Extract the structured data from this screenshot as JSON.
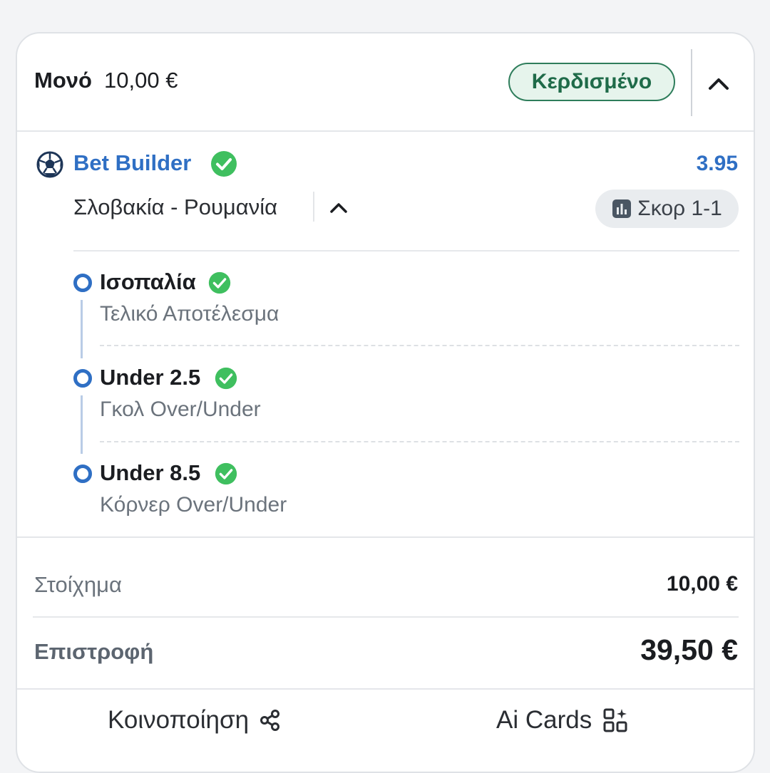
{
  "header": {
    "bet_type": "Μονό",
    "stake": "10,00 €",
    "status": "Κερδισμένο"
  },
  "builder": {
    "label": "Bet Builder",
    "odds": "3.95",
    "match": "Σλοβακία - Ρουμανία",
    "score": "Σκορ 1-1"
  },
  "selections": [
    {
      "name": "Ισοπαλία",
      "market": "Τελικό Αποτέλεσμα"
    },
    {
      "name": "Under 2.5",
      "market": "Γκολ Over/Under"
    },
    {
      "name": "Under 8.5",
      "market": "Κόρνερ Over/Under"
    }
  ],
  "summary": {
    "stake_label": "Στοίχημα",
    "stake_value": "10,00 €",
    "return_label": "Επιστροφή",
    "return_value": "39,50 €"
  },
  "actions": {
    "share": "Κοινοποίηση",
    "ai_cards": "Ai Cards"
  },
  "colors": {
    "accent_blue": "#2f6fc4",
    "win_green": "#2e7d5b",
    "check_green": "#3fbf5f"
  }
}
